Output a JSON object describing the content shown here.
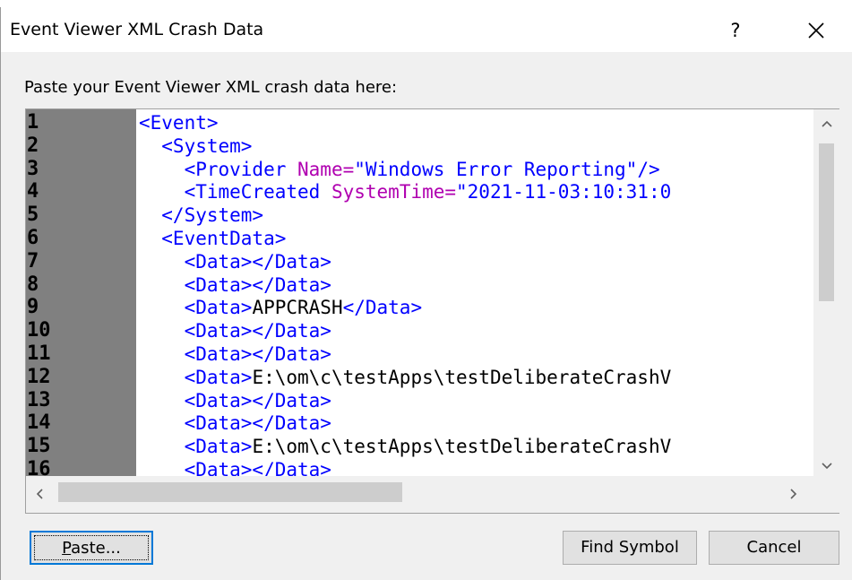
{
  "window": {
    "title": "Event Viewer XML Crash Data",
    "help_label": "?",
    "close_icon": "close-icon"
  },
  "prompt": "Paste your Event Viewer XML crash data here:",
  "editor": {
    "lines": [
      {
        "n": "1",
        "parts": [
          [
            "tag",
            "<Event>"
          ]
        ]
      },
      {
        "n": "2",
        "parts": [
          [
            "tag",
            "  <System>"
          ]
        ]
      },
      {
        "n": "3",
        "parts": [
          [
            "tag",
            "    <Provider "
          ],
          [
            "attr",
            "Name="
          ],
          [
            "aval",
            "\"Windows Error Reporting\""
          ],
          [
            "tag",
            "/>"
          ]
        ]
      },
      {
        "n": "4",
        "parts": [
          [
            "tag",
            "    <TimeCreated "
          ],
          [
            "attr",
            "SystemTime="
          ],
          [
            "aval",
            "\"2021-11-03:10:31:0"
          ]
        ]
      },
      {
        "n": "5",
        "parts": [
          [
            "tag",
            "  </System>"
          ]
        ]
      },
      {
        "n": "6",
        "parts": [
          [
            "tag",
            "  <EventData>"
          ]
        ]
      },
      {
        "n": "7",
        "parts": [
          [
            "tag",
            "    <Data></Data>"
          ]
        ]
      },
      {
        "n": "8",
        "parts": [
          [
            "tag",
            "    <Data></Data>"
          ]
        ]
      },
      {
        "n": "9",
        "parts": [
          [
            "tag",
            "    <Data>"
          ],
          [
            "txt",
            "APPCRASH"
          ],
          [
            "tag",
            "</Data>"
          ]
        ]
      },
      {
        "n": "10",
        "parts": [
          [
            "tag",
            "    <Data></Data>"
          ]
        ]
      },
      {
        "n": "11",
        "parts": [
          [
            "tag",
            "    <Data></Data>"
          ]
        ]
      },
      {
        "n": "12",
        "parts": [
          [
            "tag",
            "    <Data>"
          ],
          [
            "txt",
            "E:\\om\\c\\testApps\\testDeliberateCrashV"
          ]
        ]
      },
      {
        "n": "13",
        "parts": [
          [
            "tag",
            "    <Data></Data>"
          ]
        ]
      },
      {
        "n": "14",
        "parts": [
          [
            "tag",
            "    <Data></Data>"
          ]
        ]
      },
      {
        "n": "15",
        "parts": [
          [
            "tag",
            "    <Data>"
          ],
          [
            "txt",
            "E:\\om\\c\\testApps\\testDeliberateCrashV"
          ]
        ]
      },
      {
        "n": "16",
        "parts": [
          [
            "tag",
            "    <Data></Data>"
          ]
        ]
      }
    ]
  },
  "buttons": {
    "paste": "Paste...",
    "find_symbol": "Find Symbol",
    "cancel": "Cancel"
  },
  "colors": {
    "tag": "#0000ff",
    "attribute": "#b000b0",
    "text": "#000000",
    "gutter": "#808080"
  }
}
